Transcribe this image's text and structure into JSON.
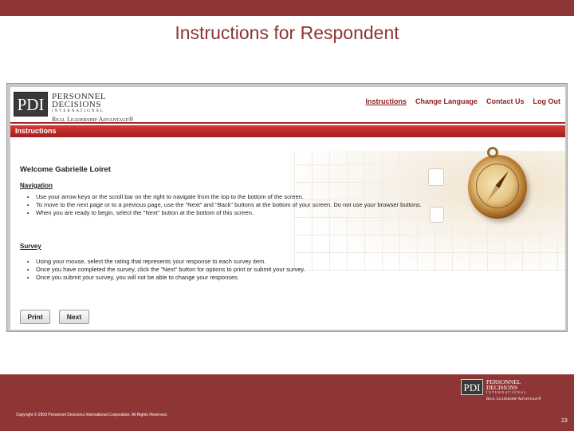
{
  "slide": {
    "title": "Instructions for Respondent",
    "copyright": "Copyright © 2009 Personnel Decisions International Corporation. All Rights Reserved.",
    "page_number": "23",
    "colors": {
      "brand": "#8e3536",
      "accent_red": "#b52424"
    }
  },
  "app": {
    "logo": {
      "mark": "PDI",
      "name_line1": "PERSONNEL",
      "name_line2": "DECISIONS",
      "international": "INTERNATIONAL",
      "tagline": "Real Leadership Advantage®"
    },
    "nav": {
      "instructions": "Instructions",
      "change_language": "Change Language",
      "contact_us": "Contact Us",
      "log_out": "Log Out"
    },
    "section_title": "Instructions",
    "welcome": "Welcome Gabrielle Loiret",
    "navigation": {
      "heading": "Navigation",
      "items": [
        "Use your arrow keys or the scroll bar on the right to navigate from the top to the bottom of the screen.",
        "To move to the next page or to a previous page, use the \"Next\" and \"Back\" buttons at the bottom of your screen. Do not use your browser buttons.",
        "When you are ready to begin, select the \"Next\" button at the bottom of this screen."
      ]
    },
    "survey": {
      "heading": "Survey",
      "items": [
        "Using your mouse, select the rating that represents your response to each survey item.",
        "Once you have completed the survey, click the \"Next\" button for options to print or submit your survey.",
        "Once you submit your survey, you will not be able to change your responses."
      ]
    },
    "buttons": {
      "print": "Print",
      "next": "Next"
    }
  }
}
